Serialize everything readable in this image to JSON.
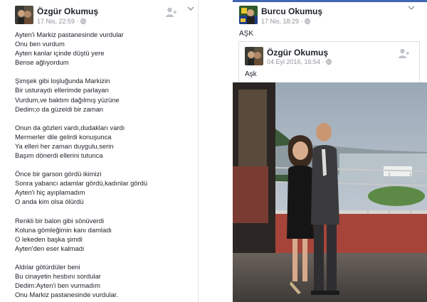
{
  "left_post": {
    "author": "Özgür Okumuş",
    "timestamp": "17 Nis, 22:59",
    "privacy_icon": "globe-icon",
    "stanzas": [
      [
        "Ayten'i Markiz pastanesinde vurdular",
        "Onu ben vurdum",
        "Ayten kanlar içinde düştü yere",
        "Bense ağlıyordum"
      ],
      [
        "Şimşek gibi loşluğunda Markizin",
        "Bir usturaydı ellerimde parlayan",
        "Vurdum,ve baktım dağılmış yüzüne",
        "Dedim;o da güzeldi bir zaman"
      ],
      [
        "Onun da gözleri vardı,dudakları vardı",
        "Mermerler dile gelirdi konuşunca",
        "Ya elleri her zaman duygulu,serin",
        "Başım dönerdi ellerini tutunca"
      ],
      [
        "Önce bir garson gördü ikimizi",
        "Sonra yabancı adamlar gördü,kadınlar gördü",
        "Ayten'i hiç ayıplamadım",
        "O anda kim olsa ölürdü"
      ],
      [
        "Renkli bir balon gibi sönüverdi",
        "Koluna gömleğimin kanı damladı",
        "O lekeden başka şimdi",
        "Ayten'den eser kalmadı"
      ],
      [
        "Aldılar götürdüler beni",
        "Bu cinayetin hesbını sordular",
        "Dedim:Ayten'i ben vurmadım",
        "Onu Markiz pastanesinde vurdular."
      ]
    ]
  },
  "right_post": {
    "author": "Burcu Okumuş",
    "timestamp": "17 Nis, 18:29",
    "privacy_icon": "globe-icon",
    "text": "AŞK",
    "shared": {
      "author": "Özgür Okumuş",
      "timestamp": "04 Eyl 2016, 16:54",
      "text": "Aşk"
    }
  },
  "colors": {
    "text": "#1d2129",
    "meta": "#90949c",
    "border": "#dddfe2",
    "accent": "#4267b2"
  }
}
